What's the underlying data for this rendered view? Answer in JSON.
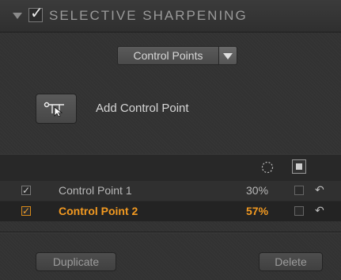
{
  "header": {
    "title": "SELECTIVE SHARPENING",
    "enabled_check": "✓"
  },
  "dropdown": {
    "selected": "Control Points"
  },
  "add_control_point": {
    "label": "Add Control Point"
  },
  "table": {
    "columns": [
      "opacity-circle-icon",
      "mask-square-icon"
    ],
    "rows": [
      {
        "checked": "✓",
        "name": "Control Point 1",
        "percent": "30%",
        "selected": false
      },
      {
        "checked": "✓",
        "name": "Control Point 2",
        "percent": "57%",
        "selected": true
      }
    ],
    "undo_glyph": "↶"
  },
  "buttons": {
    "duplicate": "Duplicate",
    "delete": "Delete"
  },
  "colors": {
    "accent": "#f39a21",
    "panel": "#323232"
  }
}
